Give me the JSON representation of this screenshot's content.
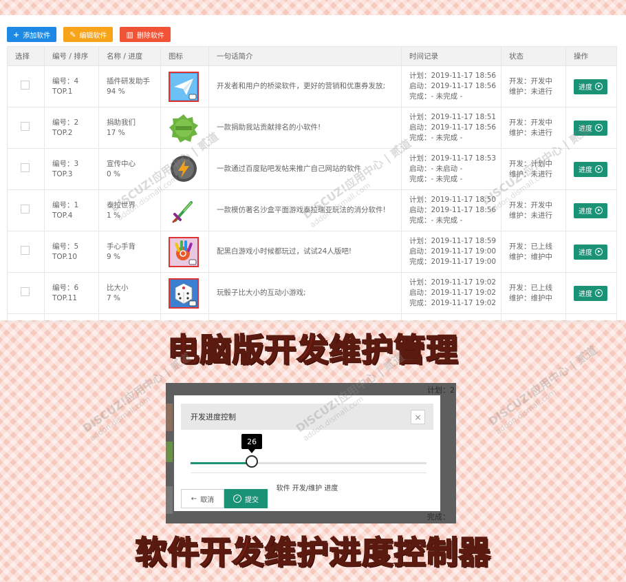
{
  "toolbar": {
    "add": "添加软件",
    "edit": "编辑软件",
    "delete": "删除软件"
  },
  "table": {
    "headers": [
      "选择",
      "编号 / 排序",
      "名称 / 进度",
      "图标",
      "一句话简介",
      "时间记录",
      "状态",
      "操作"
    ],
    "action_label": "进度",
    "rows": [
      {
        "id": "编号：4",
        "top": "TOP.1",
        "name": "插件研发助手",
        "progress": "94 %",
        "icon": "paper-plane-icon",
        "desc": "开发者和用户的桥梁软件，更好的营销和优惠券发放;",
        "plan": "计划：2019-11-17 18:56",
        "start": "启动：2019-11-17 18:56",
        "done": "完成：- 未完成 -",
        "dev": "开发：开发中",
        "maint": "维护：未进行"
      },
      {
        "id": "编号：2",
        "top": "TOP.2",
        "name": "捐助我们",
        "progress": "17 %",
        "icon": "green-badge-icon",
        "desc": "一款捐助我站贡献排名的小软件!",
        "plan": "计划：2019-11-17 18:51",
        "start": "启动：2019-11-17 18:56",
        "done": "完成：- 未完成 -",
        "dev": "开发：开发中",
        "maint": "维护：未进行"
      },
      {
        "id": "编号：3",
        "top": "TOP.3",
        "name": "宣传中心",
        "progress": "0 %",
        "icon": "lightning-bubble-icon",
        "desc": "一款通过百度贴吧发帖来推广自己网站的软件",
        "plan": "计划：2019-11-17 18:53",
        "start": "启动：- 未启动 -",
        "done": "完成：- 未完成 -",
        "dev": "开发：计划中",
        "maint": "维护：未进行"
      },
      {
        "id": "编号：1",
        "top": "TOP.4",
        "name": "泰拉世界",
        "progress": "1 %",
        "icon": "sword-icon",
        "desc": "一款模仿著名沙盒平面游戏泰拉瑞亚玩法的消分软件!",
        "plan": "计划：2019-11-17 18:50",
        "start": "启动：2019-11-17 18:56",
        "done": "完成：- 未完成 -",
        "dev": "开发：开发中",
        "maint": "维护：未进行"
      },
      {
        "id": "编号：5",
        "top": "TOP.10",
        "name": "手心手背",
        "progress": "9 %",
        "icon": "hand-icon",
        "desc": "配黑白游戏小时候都玩过，试试24人版吧!",
        "plan": "计划：2019-11-17 18:59",
        "start": "启动：2019-11-17 19:00",
        "done": "完成：2019-11-17 19:00",
        "dev": "开发：已上线",
        "maint": "维护：维护中"
      },
      {
        "id": "编号：6",
        "top": "TOP.11",
        "name": "比大小",
        "progress": "7 %",
        "icon": "dice-icon",
        "desc": "玩骰子比大小的互动小游戏;",
        "plan": "计划：2019-11-17 19:02",
        "start": "启动：2019-11-17 19:02",
        "done": "完成：2019-11-17 19:02",
        "dev": "开发：已上线",
        "maint": "维护：维护中"
      }
    ]
  },
  "headline_top": "电脑版开发维护管理",
  "headline_bottom": "软件开发维护进度控制器",
  "dialog": {
    "title": "开发进度控制",
    "close": "×",
    "slider_value": 26,
    "slider_value_text": "26",
    "caption": "软件 开发/维护 进度",
    "cancel": "取消",
    "submit": "提交",
    "bg_plan": "计划：2",
    "bg_done": "完成："
  },
  "watermark": {
    "brand": "DISCUZ!应用中心 | 贰道",
    "site": "addon.dismall.com"
  },
  "colors": {
    "accent": "#1a9276",
    "blue": "#1e88e5",
    "orange": "#f7a41b",
    "red": "#ef5235",
    "headline": "#e8231b"
  }
}
